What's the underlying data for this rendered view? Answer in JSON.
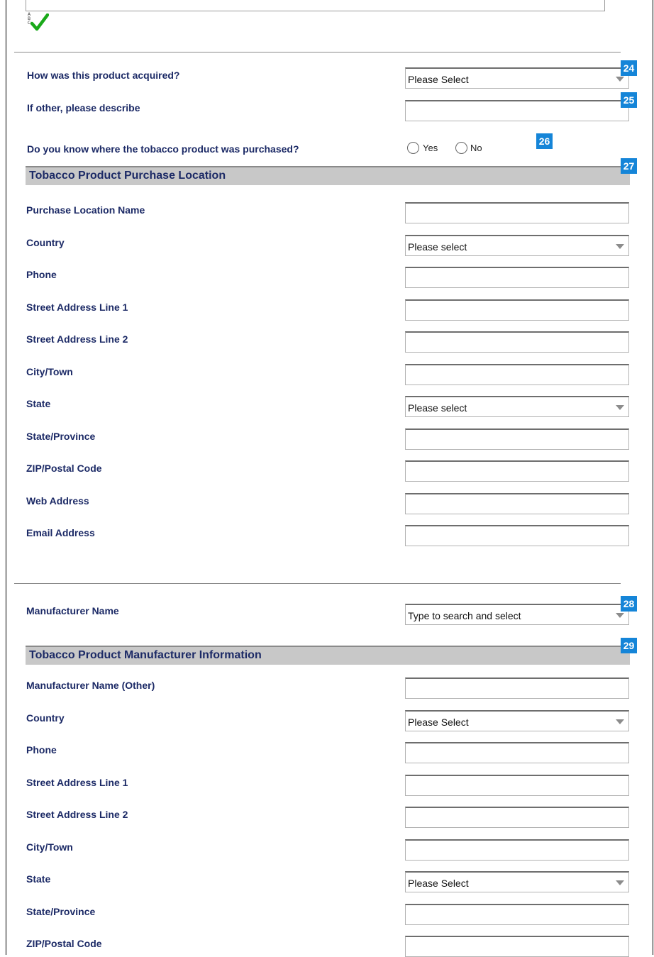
{
  "spellcheck": {
    "letters": [
      "A",
      "B",
      "C"
    ],
    "icon": "spellcheck-checkmark-icon"
  },
  "acquisition": {
    "question_label": "How was this product acquired?",
    "question_value": "Please Select",
    "question_badge": "24",
    "other_label": "If other, please describe",
    "other_value": "",
    "other_badge": "25",
    "purchase_known_label": "Do you know where the tobacco product was purchased?",
    "purchase_known_options": [
      "Yes",
      "No"
    ],
    "purchase_known_badge": "26"
  },
  "purchase_location": {
    "section_title": "Tobacco Product Purchase Location",
    "section_badge": "27",
    "fields": [
      {
        "label": "Purchase Location Name",
        "type": "text",
        "value": ""
      },
      {
        "label": "Country",
        "type": "select",
        "value": "Please select"
      },
      {
        "label": "Phone",
        "type": "text",
        "value": ""
      },
      {
        "label": "Street Address Line 1",
        "type": "text",
        "value": ""
      },
      {
        "label": "Street Address Line 2",
        "type": "text",
        "value": ""
      },
      {
        "label": "City/Town",
        "type": "text",
        "value": ""
      },
      {
        "label": "State",
        "type": "select",
        "value": "Please select"
      },
      {
        "label": "State/Province",
        "type": "text",
        "value": ""
      },
      {
        "label": "ZIP/Postal Code",
        "type": "text",
        "value": ""
      },
      {
        "label": "Web Address",
        "type": "text",
        "value": ""
      },
      {
        "label": "Email Address",
        "type": "text",
        "value": ""
      }
    ]
  },
  "manufacturer": {
    "name_label": "Manufacturer Name",
    "name_placeholder": "Type to search and select",
    "name_badge": "28",
    "section_title": "Tobacco Product Manufacturer Information",
    "section_badge": "29",
    "fields": [
      {
        "label": "Manufacturer Name (Other)",
        "type": "text",
        "value": ""
      },
      {
        "label": "Country",
        "type": "select",
        "value": "Please Select"
      },
      {
        "label": "Phone",
        "type": "text",
        "value": ""
      },
      {
        "label": "Street Address Line 1",
        "type": "text",
        "value": ""
      },
      {
        "label": "Street Address Line 2",
        "type": "text",
        "value": ""
      },
      {
        "label": "City/Town",
        "type": "text",
        "value": ""
      },
      {
        "label": "State",
        "type": "select",
        "value": "Please Select"
      },
      {
        "label": "State/Province",
        "type": "text",
        "value": ""
      },
      {
        "label": "ZIP/Postal Code",
        "type": "text",
        "value": ""
      }
    ]
  },
  "colors": {
    "label_text": "#1c2a66",
    "badge_background": "#1585d8",
    "section_background": "#c8c8c8",
    "checkmark": "#1aa91a"
  }
}
